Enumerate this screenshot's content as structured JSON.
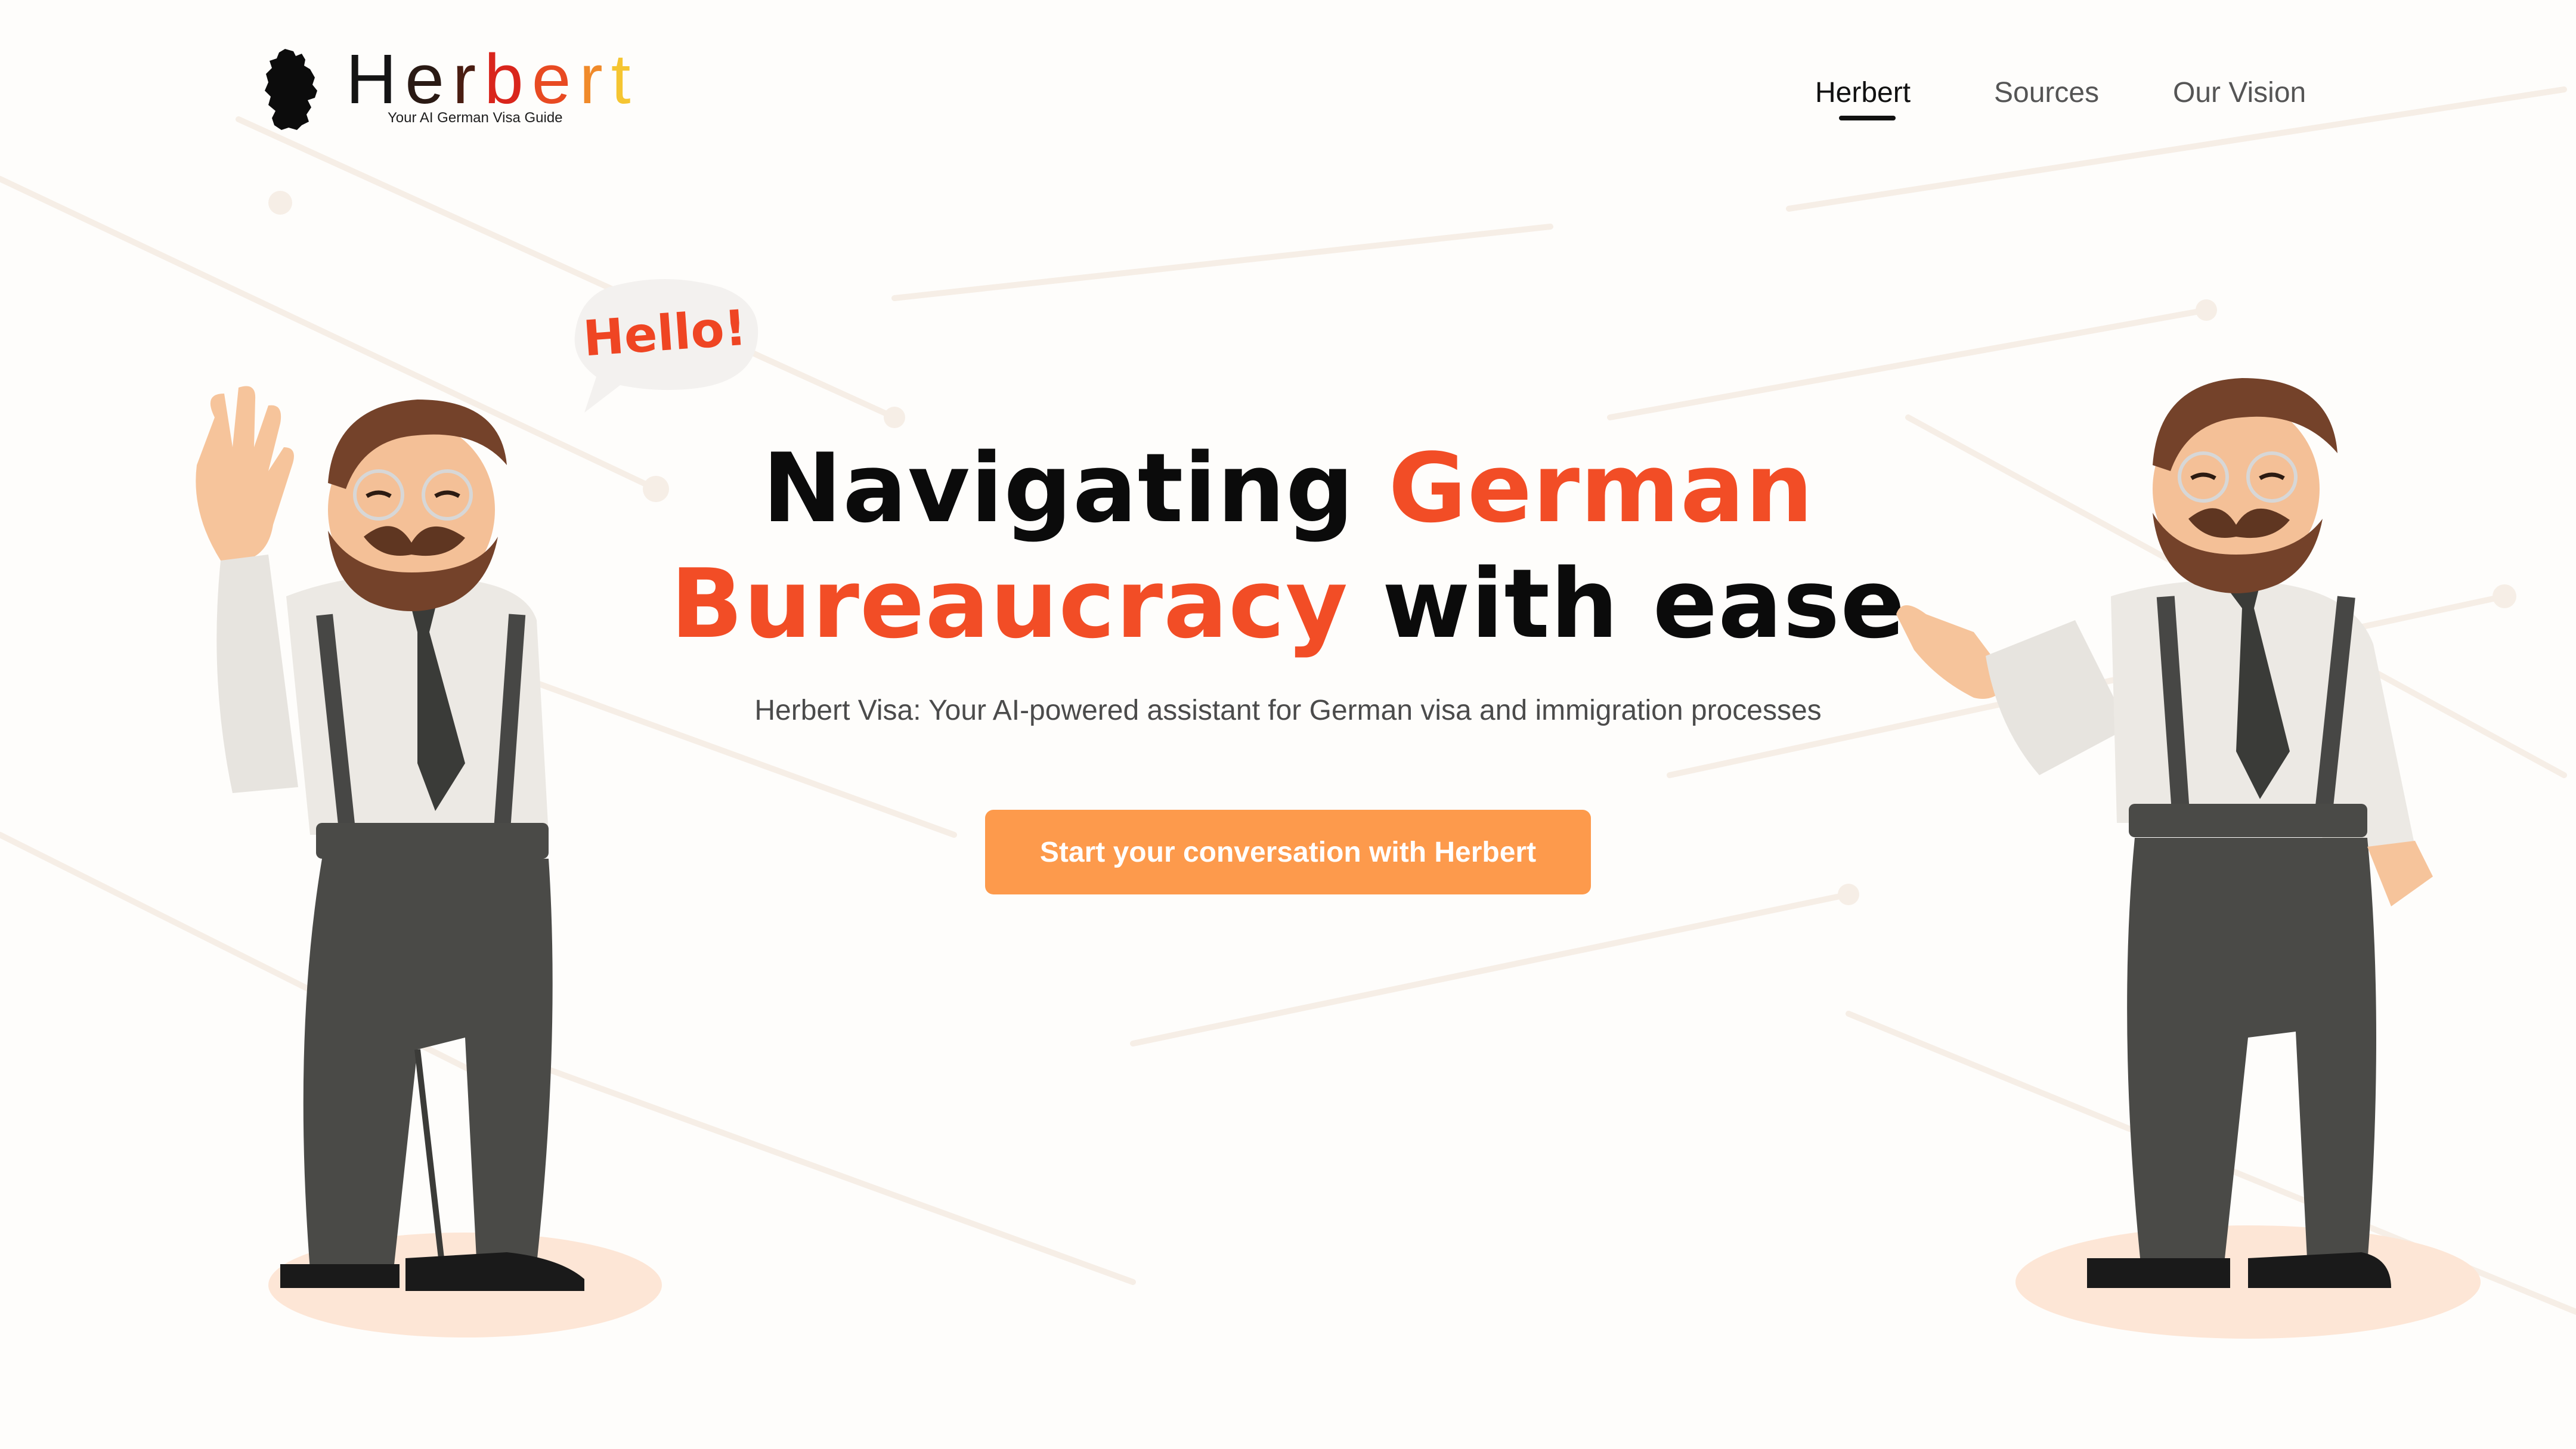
{
  "logo": {
    "letters": [
      "H",
      "e",
      "r",
      "b",
      "e",
      "r",
      "t"
    ],
    "tagline": "Your AI German Visa Guide"
  },
  "nav": {
    "items": [
      {
        "label": "Herbert",
        "active": true
      },
      {
        "label": "Sources",
        "active": false
      },
      {
        "label": "Our Vision",
        "active": false
      }
    ]
  },
  "hero": {
    "line1_dark": "Navigating",
    "line1_accent": "German",
    "line2_accent": "Bureaucracy",
    "line2_dark": "with ease",
    "subtitle": "Herbert Visa: Your AI-powered assistant for German visa and immigration processes",
    "cta_label": "Start your conversation with Herbert"
  },
  "speech_bubble": {
    "text": "Hello!"
  },
  "colors": {
    "accent": "#f24d26",
    "cta": "#fd9a4c",
    "text_dark": "#0b0b0b",
    "text_muted": "#4b4b4b",
    "background": "#fefdfb"
  },
  "icons": {
    "logo_mark": "germany-map-icon",
    "left_character": "herbert-waving-illustration",
    "right_character": "herbert-presenting-illustration"
  }
}
